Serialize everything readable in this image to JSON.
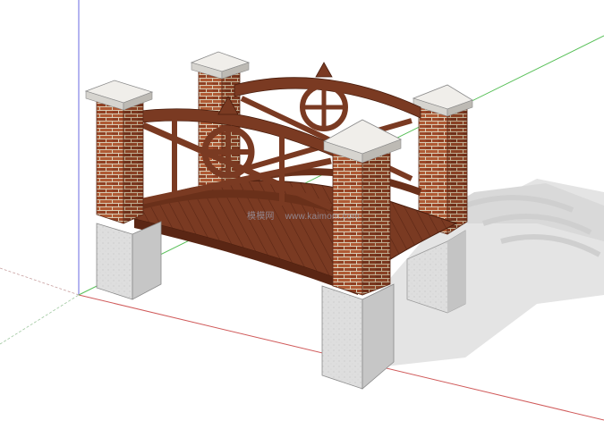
{
  "viewport": {
    "background": "#ffffff",
    "axis_colors": {
      "red": "#d05a5a",
      "green": "#58c058",
      "blue": "#6a6ae0"
    },
    "model": {
      "name": "brick-post-wooden-bridge",
      "colors": {
        "brick": "#9c4b2c",
        "brick_light": "#b8633c",
        "mortar": "#d8cbb2",
        "wood": "#7a3a22",
        "wood_dark": "#5a2614",
        "stone": "#dcdcdc",
        "stone_shadow": "#b8b8b8",
        "cap": "#e9e6e1",
        "shadow": "#e6e6e6"
      }
    },
    "watermark": {
      "site_name": "模模网",
      "url": "www.kaimom.com"
    }
  }
}
